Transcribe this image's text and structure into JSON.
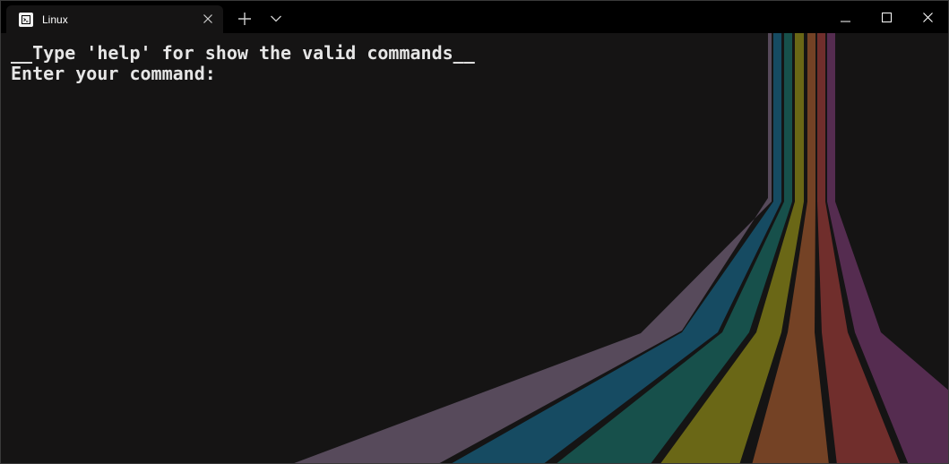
{
  "tabs": [
    {
      "title": "Linux",
      "icon": "terminal-icon"
    }
  ],
  "titlebar_icons": {
    "new_tab": "plus-icon",
    "dropdown": "chevron-down-icon",
    "minimize": "minimize-icon",
    "maximize": "maximize-icon",
    "close": "close-icon"
  },
  "terminal": {
    "lines": [
      "__Type 'help' for show the valid commands__",
      "Enter your command:"
    ]
  },
  "colors": {
    "background": "#151414",
    "titlebar": "#000000",
    "text": "#e6e6e6",
    "stripes": [
      "#574a5b",
      "#164b62",
      "#17504b",
      "#6a6716",
      "#744225",
      "#702e2c",
      "#552c50"
    ]
  }
}
